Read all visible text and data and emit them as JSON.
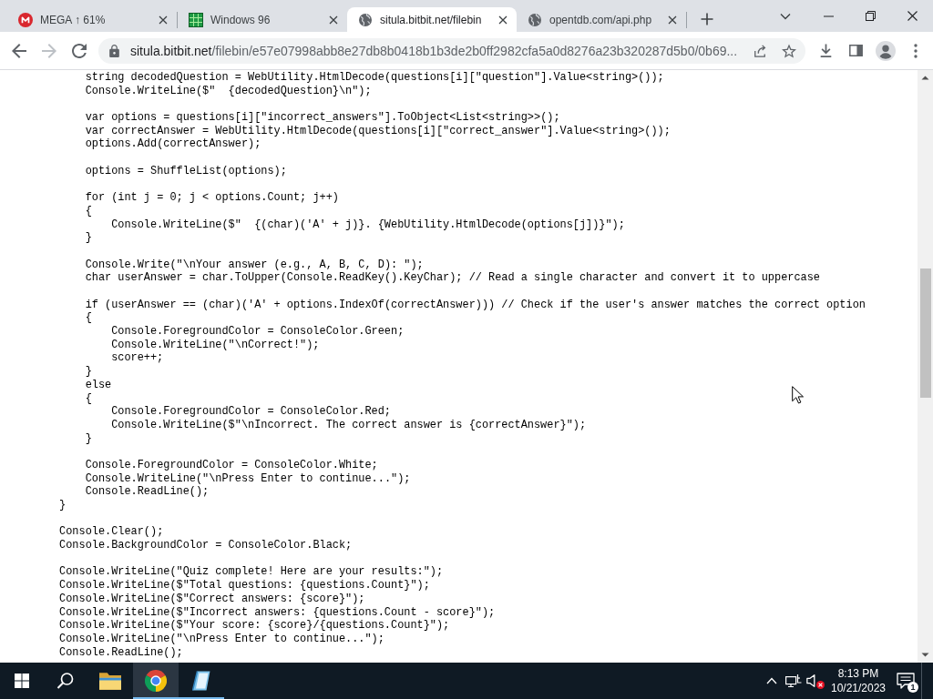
{
  "browser": {
    "tabs": [
      {
        "kind": "mega",
        "title": "MEGA ↑ 61%",
        "selected": false
      },
      {
        "kind": "grid",
        "title": "Windows 96",
        "selected": false
      },
      {
        "kind": "globe",
        "title": "situla.bitbit.net/filebin",
        "selected": true
      },
      {
        "kind": "globe",
        "title": "opentdb.com/api.php",
        "selected": false
      }
    ],
    "toolbar": {
      "nav": [
        {
          "kind": "back",
          "disabled": false
        },
        {
          "kind": "forward",
          "disabled": true
        },
        {
          "kind": "reload",
          "disabled": false
        }
      ],
      "address": {
        "host": "situla.bitbit.net",
        "path": "/filebin/e57e07998abb8e27db8b0418b1b3de2b0ff2982cfa5a0d8276a23b320287d5b0/0b69..."
      }
    }
  },
  "code": {
    "blocks": [
      [
        "            string decodedQuestion = WebUtility.HtmlDecode(questions[i][\"question\"].Value<string>());",
        "            Console.WriteLine($\"  {decodedQuestion}\\n\");"
      ],
      [
        "            var options = questions[i][\"incorrect_answers\"].ToObject<List<string>>();",
        "            var correctAnswer = WebUtility.HtmlDecode(questions[i][\"correct_answer\"].Value<string>());",
        "            options.Add(correctAnswer);"
      ],
      [
        "            options = ShuffleList(options);"
      ],
      [
        "            for (int j = 0; j < options.Count; j++)",
        "            {",
        "                Console.WriteLine($\"  {(char)('A' + j)}. {WebUtility.HtmlDecode(options[j])}\");",
        "            }"
      ],
      [
        "            Console.Write(\"\\nYour answer (e.g., A, B, C, D): \");",
        "            char userAnswer = char.ToUpper(Console.ReadKey().KeyChar); // Read a single character and convert it to uppercase"
      ],
      [
        "            if (userAnswer == (char)('A' + options.IndexOf(correctAnswer))) // Check if the user's answer matches the correct option",
        "            {",
        "                Console.ForegroundColor = ConsoleColor.Green;",
        "                Console.WriteLine(\"\\nCorrect!\");",
        "                score++;",
        "            }",
        "            else",
        "            {",
        "                Console.ForegroundColor = ConsoleColor.Red;",
        "                Console.WriteLine($\"\\nIncorrect. The correct answer is {correctAnswer}\");",
        "            }"
      ],
      [
        "            Console.ForegroundColor = ConsoleColor.White;",
        "            Console.WriteLine(\"\\nPress Enter to continue...\");",
        "            Console.ReadLine();",
        "        }"
      ],
      [
        "        Console.Clear();",
        "        Console.BackgroundColor = ConsoleColor.Black;"
      ],
      [
        "        Console.WriteLine(\"Quiz complete! Here are your results:\");",
        "        Console.WriteLine($\"Total questions: {questions.Count}\");",
        "        Console.WriteLine($\"Correct answers: {score}\");",
        "        Console.WriteLine($\"Incorrect answers: {questions.Count - score}\");",
        "        Console.WriteLine($\"Your score: {score}/{questions.Count}\");",
        "        Console.WriteLine(\"\\nPress Enter to continue...\");",
        "        Console.ReadLine();"
      ]
    ]
  },
  "taskbar": {
    "apps": [
      {
        "kind": "folder",
        "selected": false,
        "running": false
      },
      {
        "kind": "browser",
        "selected": true,
        "running": true
      },
      {
        "kind": "notepad",
        "selected": false,
        "running": true
      }
    ],
    "tray": {
      "volume_muted": true,
      "time": "8:13 PM",
      "date": "10/21/2023",
      "notifications": "1"
    }
  }
}
